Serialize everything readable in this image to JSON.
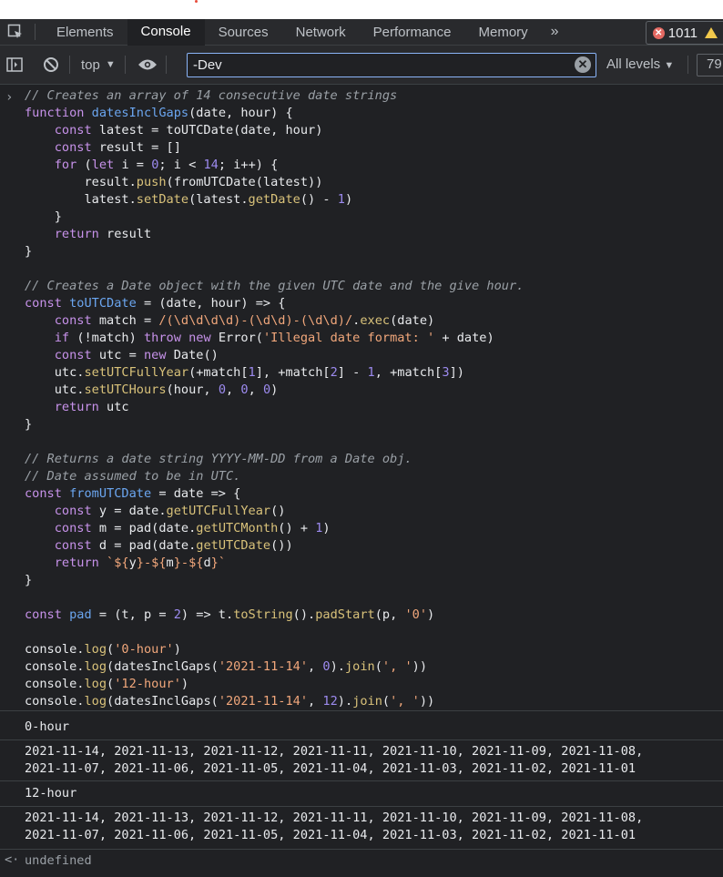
{
  "tabs": [
    {
      "label": "Elements"
    },
    {
      "label": "Console"
    },
    {
      "label": "Sources"
    },
    {
      "label": "Network"
    },
    {
      "label": "Performance"
    },
    {
      "label": "Memory"
    }
  ],
  "more_tabs": "»",
  "error_count": "1011",
  "toolbar": {
    "context": "top",
    "filter_value": "-Dev",
    "levels": "All levels",
    "hidden_count": "79"
  },
  "code_lines": [
    [
      [
        "cm",
        "// Creates an array of 14 consecutive date strings"
      ]
    ],
    [
      [
        "kw",
        "function "
      ],
      [
        "fd",
        "datesInclGaps"
      ],
      [
        "op",
        "(date, hour) {"
      ]
    ],
    [
      [
        "op",
        "    "
      ],
      [
        "kw",
        "const "
      ],
      [
        "op",
        "latest = toUTCDate(date, hour)"
      ]
    ],
    [
      [
        "op",
        "    "
      ],
      [
        "kw",
        "const "
      ],
      [
        "op",
        "result = []"
      ]
    ],
    [
      [
        "op",
        "    "
      ],
      [
        "kw",
        "for "
      ],
      [
        "op",
        "("
      ],
      [
        "kw",
        "let "
      ],
      [
        "op",
        "i = "
      ],
      [
        "nm",
        "0"
      ],
      [
        "op",
        "; i < "
      ],
      [
        "nm",
        "14"
      ],
      [
        "op",
        "; i++) {"
      ]
    ],
    [
      [
        "op",
        "        result."
      ],
      [
        "fn",
        "push"
      ],
      [
        "op",
        "(fromUTCDate(latest))"
      ]
    ],
    [
      [
        "op",
        "        latest."
      ],
      [
        "fn",
        "setDate"
      ],
      [
        "op",
        "(latest."
      ],
      [
        "fn",
        "getDate"
      ],
      [
        "op",
        "() - "
      ],
      [
        "nm",
        "1"
      ],
      [
        "op",
        ")"
      ]
    ],
    [
      [
        "op",
        "    }"
      ]
    ],
    [
      [
        "op",
        "    "
      ],
      [
        "kw",
        "return "
      ],
      [
        "op",
        "result"
      ]
    ],
    [
      [
        "op",
        "}"
      ]
    ],
    [
      [
        "op",
        ""
      ]
    ],
    [
      [
        "cm",
        "// Creates a Date object with the given UTC date and the give hour."
      ]
    ],
    [
      [
        "kw",
        "const "
      ],
      [
        "fd",
        "toUTCDate"
      ],
      [
        "op",
        " = (date, hour) => {"
      ]
    ],
    [
      [
        "op",
        "    "
      ],
      [
        "kw",
        "const "
      ],
      [
        "op",
        "match = "
      ],
      [
        "st",
        "/(\\d\\d\\d\\d)-(\\d\\d)-(\\d\\d)/"
      ],
      [
        "op",
        "."
      ],
      [
        "fn",
        "exec"
      ],
      [
        "op",
        "(date)"
      ]
    ],
    [
      [
        "op",
        "    "
      ],
      [
        "kw",
        "if "
      ],
      [
        "op",
        "(!match) "
      ],
      [
        "kw",
        "throw new "
      ],
      [
        "op",
        "Error("
      ],
      [
        "st",
        "'Illegal date format: '"
      ],
      [
        "op",
        " + date)"
      ]
    ],
    [
      [
        "op",
        "    "
      ],
      [
        "kw",
        "const "
      ],
      [
        "op",
        "utc = "
      ],
      [
        "kw",
        "new "
      ],
      [
        "op",
        "Date()"
      ]
    ],
    [
      [
        "op",
        "    utc."
      ],
      [
        "fn",
        "setUTCFullYear"
      ],
      [
        "op",
        "(+match["
      ],
      [
        "nm",
        "1"
      ],
      [
        "op",
        "], +match["
      ],
      [
        "nm",
        "2"
      ],
      [
        "op",
        "] - "
      ],
      [
        "nm",
        "1"
      ],
      [
        "op",
        ", +match["
      ],
      [
        "nm",
        "3"
      ],
      [
        "op",
        "])"
      ]
    ],
    [
      [
        "op",
        "    utc."
      ],
      [
        "fn",
        "setUTCHours"
      ],
      [
        "op",
        "(hour, "
      ],
      [
        "nm",
        "0"
      ],
      [
        "op",
        ", "
      ],
      [
        "nm",
        "0"
      ],
      [
        "op",
        ", "
      ],
      [
        "nm",
        "0"
      ],
      [
        "op",
        ")"
      ]
    ],
    [
      [
        "op",
        "    "
      ],
      [
        "kw",
        "return "
      ],
      [
        "op",
        "utc"
      ]
    ],
    [
      [
        "op",
        "}"
      ]
    ],
    [
      [
        "op",
        ""
      ]
    ],
    [
      [
        "cm",
        "// Returns a date string YYYY-MM-DD from a Date obj."
      ]
    ],
    [
      [
        "cm",
        "// Date assumed to be in UTC."
      ]
    ],
    [
      [
        "kw",
        "const "
      ],
      [
        "fd",
        "fromUTCDate"
      ],
      [
        "op",
        " = date => {"
      ]
    ],
    [
      [
        "op",
        "    "
      ],
      [
        "kw",
        "const "
      ],
      [
        "op",
        "y = date."
      ],
      [
        "fn",
        "getUTCFullYear"
      ],
      [
        "op",
        "()"
      ]
    ],
    [
      [
        "op",
        "    "
      ],
      [
        "kw",
        "const "
      ],
      [
        "op",
        "m = pad(date."
      ],
      [
        "fn",
        "getUTCMonth"
      ],
      [
        "op",
        "() + "
      ],
      [
        "nm",
        "1"
      ],
      [
        "op",
        ")"
      ]
    ],
    [
      [
        "op",
        "    "
      ],
      [
        "kw",
        "const "
      ],
      [
        "op",
        "d = pad(date."
      ],
      [
        "fn",
        "getUTCDate"
      ],
      [
        "op",
        "())"
      ]
    ],
    [
      [
        "op",
        "    "
      ],
      [
        "kw",
        "return "
      ],
      [
        "st",
        "`${"
      ],
      [
        "op",
        "y"
      ],
      [
        "st",
        "}-${"
      ],
      [
        "op",
        "m"
      ],
      [
        "st",
        "}-${"
      ],
      [
        "op",
        "d"
      ],
      [
        "st",
        "}`"
      ]
    ],
    [
      [
        "op",
        "}"
      ]
    ],
    [
      [
        "op",
        ""
      ]
    ],
    [
      [
        "kw",
        "const "
      ],
      [
        "fd",
        "pad"
      ],
      [
        "op",
        " = (t, p = "
      ],
      [
        "nm",
        "2"
      ],
      [
        "op",
        ") => t."
      ],
      [
        "fn",
        "toString"
      ],
      [
        "op",
        "()."
      ],
      [
        "fn",
        "padStart"
      ],
      [
        "op",
        "(p, "
      ],
      [
        "st",
        "'0'"
      ],
      [
        "op",
        ")"
      ]
    ],
    [
      [
        "op",
        ""
      ]
    ],
    [
      [
        "op",
        "console."
      ],
      [
        "fn",
        "log"
      ],
      [
        "op",
        "("
      ],
      [
        "st",
        "'0-hour'"
      ],
      [
        "op",
        ")"
      ]
    ],
    [
      [
        "op",
        "console."
      ],
      [
        "fn",
        "log"
      ],
      [
        "op",
        "(datesInclGaps("
      ],
      [
        "st",
        "'2021-11-14'"
      ],
      [
        "op",
        ", "
      ],
      [
        "nm",
        "0"
      ],
      [
        "op",
        ")."
      ],
      [
        "fn",
        "join"
      ],
      [
        "op",
        "("
      ],
      [
        "st",
        "', '"
      ],
      [
        "op",
        "))"
      ]
    ],
    [
      [
        "op",
        "console."
      ],
      [
        "fn",
        "log"
      ],
      [
        "op",
        "("
      ],
      [
        "st",
        "'12-hour'"
      ],
      [
        "op",
        ")"
      ]
    ],
    [
      [
        "op",
        "console."
      ],
      [
        "fn",
        "log"
      ],
      [
        "op",
        "(datesInclGaps("
      ],
      [
        "st",
        "'2021-11-14'"
      ],
      [
        "op",
        ", "
      ],
      [
        "nm",
        "12"
      ],
      [
        "op",
        ")."
      ],
      [
        "fn",
        "join"
      ],
      [
        "op",
        "("
      ],
      [
        "st",
        "', '"
      ],
      [
        "op",
        "))"
      ]
    ]
  ],
  "output": {
    "label0": "0-hour",
    "dates0_line1": "2021-11-14, 2021-11-13, 2021-11-12, 2021-11-11, 2021-11-10, 2021-11-09, 2021-11-08,",
    "dates0_line2": "2021-11-07, 2021-11-06, 2021-11-05, 2021-11-04, 2021-11-03, 2021-11-02, 2021-11-01",
    "label12": "12-hour",
    "dates12_line1": "2021-11-14, 2021-11-13, 2021-11-12, 2021-11-11, 2021-11-10, 2021-11-09, 2021-11-08,",
    "dates12_line2": "2021-11-07, 2021-11-06, 2021-11-05, 2021-11-04, 2021-11-03, 2021-11-02, 2021-11-01",
    "return_value": "undefined"
  }
}
